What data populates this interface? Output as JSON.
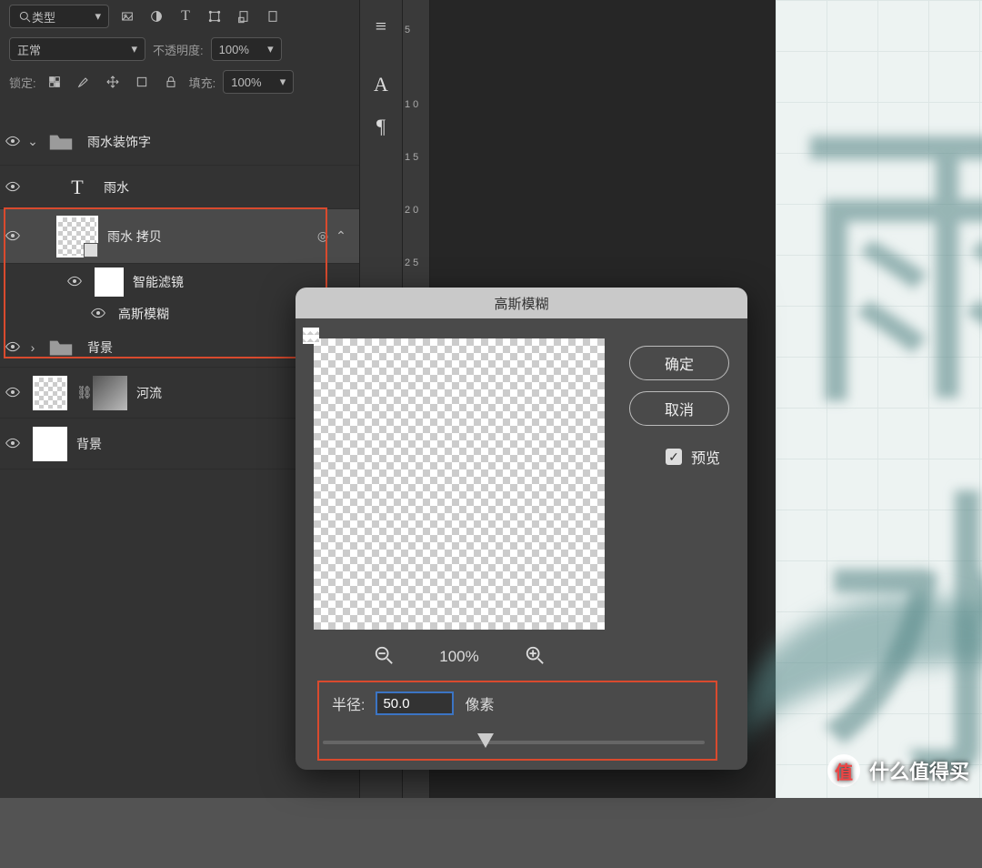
{
  "layersPanel": {
    "filter": {
      "search_label": "类型"
    },
    "blendRow": {
      "mode": "正常",
      "opacity_label": "不透明度:",
      "opacity_value": "100%"
    },
    "lockRow": {
      "lock_label": "锁定:",
      "fill_label": "填充:",
      "fill_value": "100%"
    },
    "layers": {
      "group_name": "雨水装饰字",
      "text_layer": "雨水",
      "smart_layer": "雨水 拷贝",
      "smart_filter_label": "智能滤镜",
      "gaussian_label": "高斯模糊",
      "bg_group": "背景",
      "river_layer": "河流",
      "bg_layer": "背景"
    }
  },
  "midbar": {
    "g1": "≡",
    "g2": "A",
    "g3": "¶"
  },
  "ruler": [
    "5",
    "1 0",
    "1 5",
    "2 0",
    "2 5"
  ],
  "dialog": {
    "title": "高斯模糊",
    "ok": "确定",
    "cancel": "取消",
    "preview_label": "预览",
    "zoom_pct": "100%",
    "radius_label": "半径:",
    "radius_value": "50.0",
    "radius_unit": "像素"
  },
  "watermark": {
    "badge": "值",
    "text": "什么值得买"
  },
  "doc": {
    "char1": "雨",
    "char2": "水"
  }
}
